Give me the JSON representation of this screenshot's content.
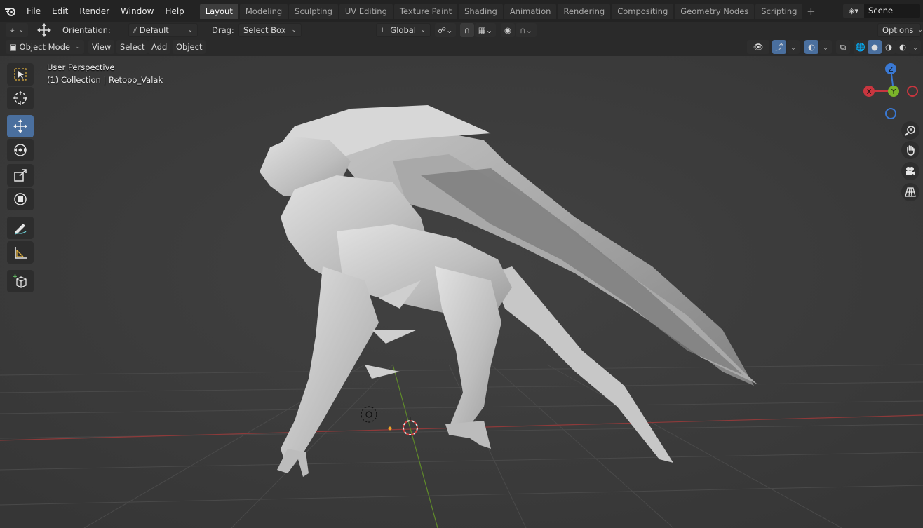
{
  "topbar": {
    "menus": [
      "File",
      "Edit",
      "Render",
      "Window",
      "Help"
    ],
    "workspaces": [
      "Layout",
      "Modeling",
      "Sculpting",
      "UV Editing",
      "Texture Paint",
      "Shading",
      "Animation",
      "Rendering",
      "Compositing",
      "Geometry Nodes",
      "Scripting"
    ],
    "active_workspace": "Layout",
    "add_tab": "+",
    "scene": "Scene"
  },
  "tool_settings": {
    "orientation_label": "Orientation:",
    "orientation_value": "Default",
    "drag_label": "Drag:",
    "drag_value": "Select Box",
    "transform_orientation": "Global",
    "options": "Options"
  },
  "header": {
    "mode": "Object Mode",
    "view": "View",
    "select": "Select",
    "add": "Add",
    "object": "Object"
  },
  "viewport": {
    "perspective": "User Perspective",
    "collection": "(1) Collection | Retopo_Valak",
    "gizmo_axes": {
      "z": "Z",
      "x": "X",
      "y": "Y"
    }
  },
  "colors": {
    "accent": "#4a6f9e",
    "x_axis": "#c8363f",
    "y_axis": "#7bb52a",
    "z_axis": "#3a79d4",
    "viewport_bg": "#3d3d3d"
  },
  "icons": {
    "tools": [
      "select-box-icon",
      "cursor-icon",
      "move-icon",
      "rotate-icon",
      "scale-icon",
      "transform-icon",
      "annotate-icon",
      "measure-icon",
      "add-cube-icon"
    ],
    "nav": [
      "zoom-icon",
      "hand-pan-icon",
      "camera-icon",
      "grid-perspective-icon"
    ]
  }
}
